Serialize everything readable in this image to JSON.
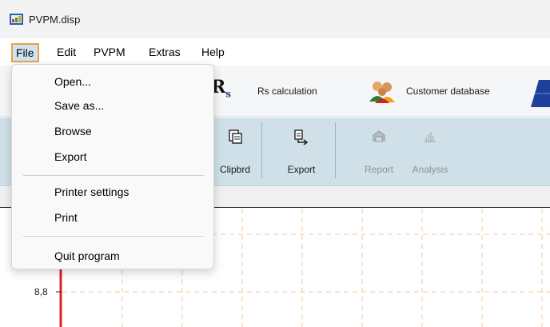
{
  "window": {
    "title": "PVPM.disp",
    "icon": "pvpm-app-icon"
  },
  "menubar": {
    "items": [
      {
        "label": "File",
        "active": true
      },
      {
        "label": "Edit"
      },
      {
        "label": "PVPM"
      },
      {
        "label": "Extras"
      },
      {
        "label": "Help"
      }
    ]
  },
  "toolbar_top": {
    "rs_icon": {
      "letter": "R",
      "subscript": "s"
    },
    "rs_calculation_label": "Rs calculation",
    "customer_database_label": "Customer database",
    "icons": [
      "rs-icon",
      "customers-icon",
      "solar-panel-icon"
    ]
  },
  "toolbar_main": {
    "clipboard_label": "Clipbrd",
    "export_label": "Export",
    "report_label": "Report",
    "analysis_label": "Analysis",
    "disabled": [
      "Report",
      "Analysis"
    ],
    "icons": [
      "clipboard-icon",
      "export-icon",
      "report-icon",
      "analysis-icon"
    ]
  },
  "plot": {
    "y_tick_label": "8,8",
    "axis_color": "#e02020",
    "grid_color": "#f2c79a"
  },
  "file_menu": {
    "items": [
      {
        "label": "Open..."
      },
      {
        "label": "Save as..."
      },
      {
        "label": "Browse"
      },
      {
        "label": "Export"
      },
      {
        "label": "Printer settings"
      },
      {
        "label": "Print"
      },
      {
        "label": "Quit program"
      }
    ]
  },
  "colors": {
    "menu_highlight_border": "#f0a13c",
    "menu_highlight_fill": "#cde4f7",
    "toolbar_bg": "#cfe0e8"
  }
}
